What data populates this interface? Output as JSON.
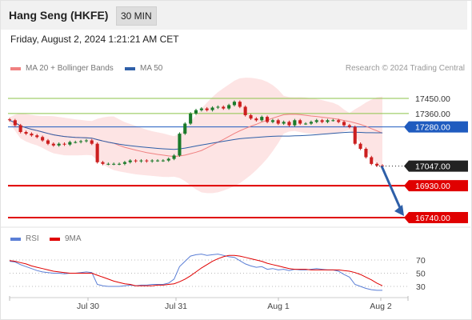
{
  "header": {
    "title": "Hang Seng (HKFE)",
    "interval": "30 MIN",
    "datetime": "Friday, August 2, 2024 1:21:21 AM CET"
  },
  "legend": {
    "ma20_label": "MA 20 + Bollinger Bands",
    "ma50_label": "MA 50",
    "credit": "Research © 2024 Trading Central"
  },
  "rsi_legend": {
    "rsi_label": "RSI",
    "ma_label": "9MA"
  },
  "colors": {
    "ma20": "#f08080",
    "ma50": "#2e5fa8",
    "bollinger_fill": "#fde4e4",
    "candle_up": "#1a7a2a",
    "candle_down": "#cc1f1f",
    "pivot": "#1f5bbf",
    "support": "#e00000",
    "resistance": "#8bc34a",
    "current_price": "#222222",
    "rsi": "#5b7fd6",
    "rsi_ma": "#e00000",
    "arrow": "#2e5fa8"
  },
  "chart_data": {
    "type": "candlestick",
    "x_tick_labels": [
      "Jul 30",
      "Jul 31",
      "Aug 1",
      "Aug 2"
    ],
    "price_levels": [
      {
        "label": "17450.00",
        "value": 17450,
        "kind": "resistance"
      },
      {
        "label": "17360.00",
        "value": 17360,
        "kind": "resistance"
      },
      {
        "label": "17280.00",
        "value": 17280,
        "kind": "pivot"
      },
      {
        "label": "17047.00",
        "value": 17047,
        "kind": "current"
      },
      {
        "label": "16930.00",
        "value": 16930,
        "kind": "support"
      },
      {
        "label": "16740.00",
        "value": 16740,
        "kind": "support"
      }
    ],
    "close_series": [
      17320,
      17290,
      17250,
      17240,
      17230,
      17220,
      17200,
      17180,
      17170,
      17180,
      17175,
      17190,
      17190,
      17195,
      17200,
      17180,
      17070,
      17060,
      17060,
      17060,
      17060,
      17070,
      17080,
      17075,
      17080,
      17075,
      17080,
      17080,
      17080,
      17090,
      17110,
      17240,
      17300,
      17360,
      17380,
      17390,
      17380,
      17395,
      17400,
      17390,
      17410,
      17430,
      17400,
      17350,
      17330,
      17320,
      17340,
      17310,
      17320,
      17300,
      17310,
      17290,
      17320,
      17300,
      17300,
      17310,
      17320,
      17310,
      17320,
      17320,
      17310,
      17290,
      17280,
      17180,
      17150,
      17100,
      17060,
      17050,
      17047
    ],
    "rsi": {
      "values": [
        68,
        67,
        63,
        60,
        57,
        54,
        52,
        51,
        50,
        50,
        49,
        50,
        50,
        51,
        52,
        51,
        33,
        31,
        30,
        30,
        30,
        31,
        32,
        31,
        32,
        32,
        33,
        33,
        33,
        35,
        41,
        60,
        68,
        76,
        78,
        79,
        77,
        78,
        79,
        77,
        75,
        74,
        69,
        64,
        61,
        59,
        60,
        56,
        57,
        55,
        56,
        54,
        56,
        55,
        55,
        56,
        57,
        56,
        55,
        55,
        53,
        48,
        44,
        33,
        30,
        27,
        25,
        24,
        24
      ],
      "ma9": [
        69,
        68,
        66,
        64,
        61,
        59,
        57,
        55,
        53,
        52,
        51,
        50,
        50,
        50,
        50,
        50,
        47,
        44,
        41,
        38,
        36,
        34,
        33,
        31,
        31,
        31,
        31,
        32,
        32,
        33,
        34,
        37,
        41,
        46,
        52,
        58,
        63,
        68,
        72,
        75,
        77,
        77,
        76,
        74,
        72,
        70,
        68,
        65,
        63,
        61,
        59,
        57,
        56,
        56,
        56,
        55,
        55,
        55,
        55,
        55,
        55,
        54,
        53,
        51,
        48,
        44,
        40,
        35,
        31
      ],
      "levels": [
        70,
        50,
        30
      ],
      "level_labels": [
        "70",
        "50",
        "30"
      ]
    }
  }
}
